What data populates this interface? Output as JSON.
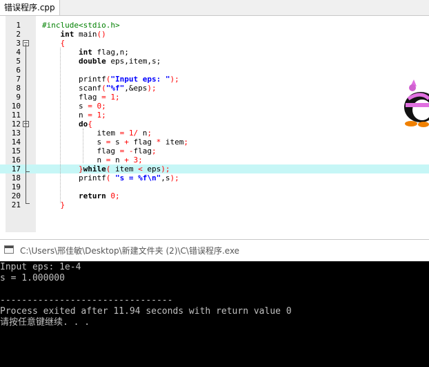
{
  "tab": {
    "title": "错误程序.cpp"
  },
  "editor": {
    "line_numbers": [
      "1",
      "2",
      "3",
      "4",
      "5",
      "6",
      "7",
      "8",
      "9",
      "10",
      "11",
      "12",
      "13",
      "14",
      "15",
      "16",
      "17",
      "18",
      "19",
      "20",
      "21"
    ],
    "current_line": "17"
  },
  "code": {
    "l1": "#include<stdio.h>",
    "l2_kw": "int",
    "l2_rest": " main",
    "l4_kw": "int",
    "l4_rest": " flag,n;",
    "l5_kw": "double",
    "l5_rest": " eps,item,s;",
    "l7_fn": "printf",
    "l7_str": "\"Input eps: \"",
    "l8_fn": "scanf",
    "l8_str": "\"%f\"",
    "l8_rest": ",&eps",
    "l9_a": "flag ",
    "l9_num": "1",
    "l10_a": "s ",
    "l10_num": "0",
    "l11_a": "n ",
    "l11_num": "1",
    "l12_kw": "do",
    "l13_a": "item ",
    "l13_num": "1",
    "l13_b": " n",
    "l14_a": "s ",
    "l14_b": " s ",
    "l14_c": " flag ",
    "l14_d": " item",
    "l15_a": "flag ",
    "l15_b": "flag",
    "l16_a": "n ",
    "l16_b": " n ",
    "l16_num": "3",
    "l17_kw": "while",
    "l17_rest": " item ",
    "l17_b": " eps",
    "l18_fn": "printf",
    "l18_str": "\"s = %f\\n\"",
    "l18_rest": ",s",
    "l20_kw": "return",
    "l20_num": "0"
  },
  "console": {
    "title": "C:\\Users\\邢佳敏\\Desktop\\新建文件夹 (2)\\C\\错误程序.exe",
    "lines": [
      "Input eps: 1e-4",
      "s = 1.000000",
      "",
      "--------------------------------",
      "Process exited after 11.94 seconds with return value 0",
      "请按任意键继续. . ."
    ]
  },
  "colors": {
    "current_line_bg": "#c6f6f6",
    "keyword": "#000000",
    "preprocessor": "#008000",
    "string": "#0000ff",
    "number": "#ff0000",
    "console_bg": "#000000",
    "console_text": "#c0c0c0"
  },
  "icons": {
    "fold_open": "minus-box-icon",
    "console": "console-window-icon",
    "mascot": "penguin-mascot-icon"
  }
}
